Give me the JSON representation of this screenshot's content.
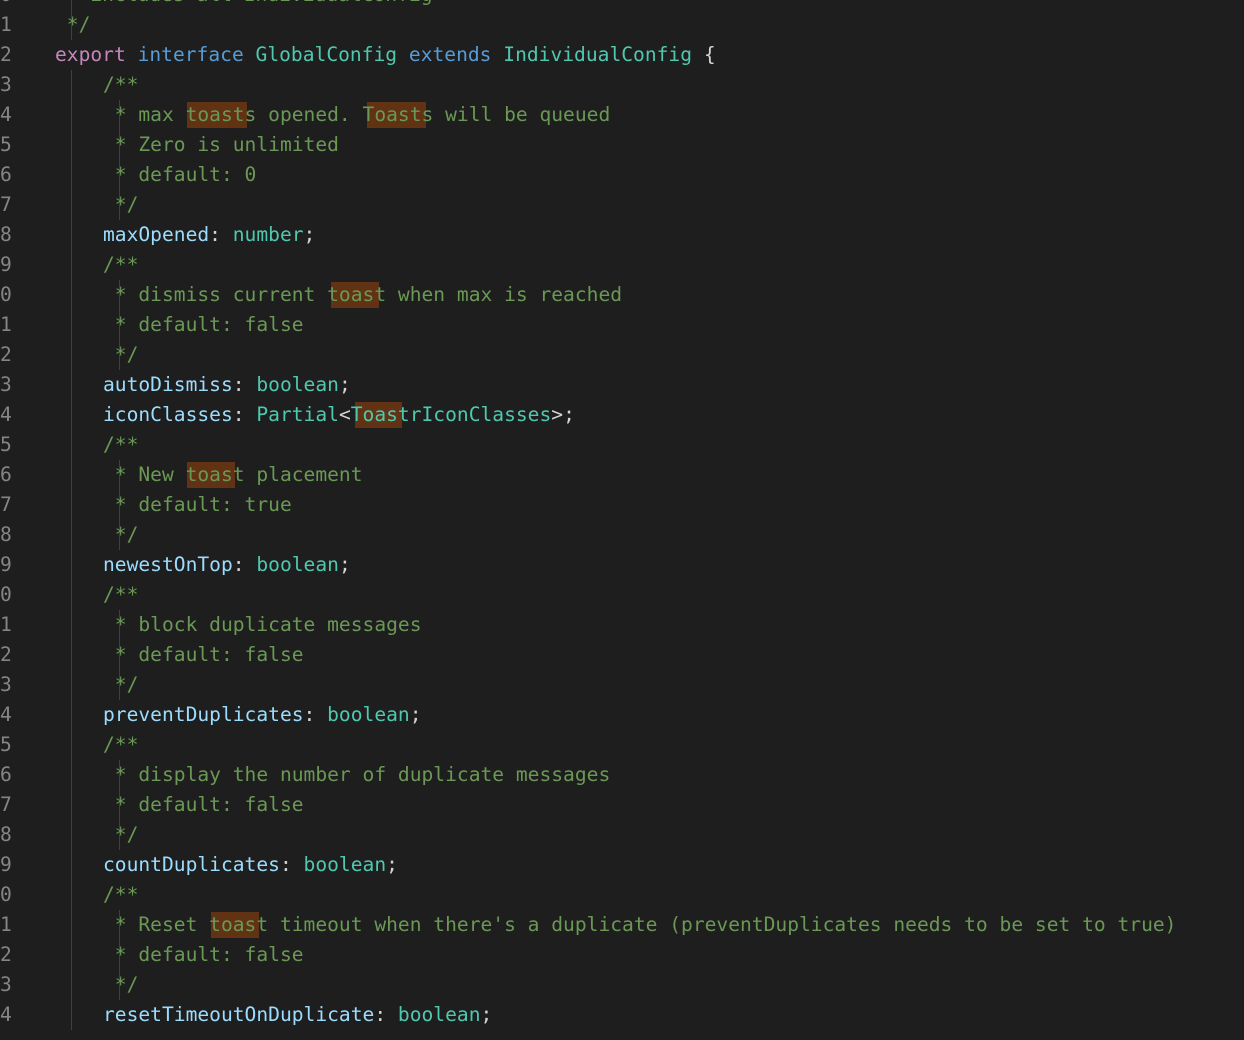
{
  "editor": {
    "theme": {
      "background": "#1e1e1e",
      "gutter_text": "#858585",
      "indent_guide": "#404040",
      "find_match": "#613214",
      "keyword": "#c586c0",
      "storage": "#569cd6",
      "type": "#4ec9b0",
      "property": "#9cdcfe",
      "comment": "#6a9955",
      "text": "#d4d4d4"
    },
    "lines": [
      {
        "num": "0",
        "indent": 0,
        "guides": [
          1
        ],
        "tokens": [
          {
            "t": " * includes all IndividualConfig",
            "c": "cm"
          }
        ],
        "matches": []
      },
      {
        "num": "1",
        "indent": 0,
        "guides": [
          1
        ],
        "tokens": [
          {
            "t": " */",
            "c": "cm"
          }
        ],
        "matches": []
      },
      {
        "num": "2",
        "indent": 0,
        "guides": [],
        "tokens": [
          {
            "t": "export",
            "c": "kw"
          },
          {
            "t": " ",
            "c": "pu"
          },
          {
            "t": "interface",
            "c": "st"
          },
          {
            "t": " ",
            "c": "pu"
          },
          {
            "t": "GlobalConfig",
            "c": "ty"
          },
          {
            "t": " ",
            "c": "pu"
          },
          {
            "t": "extends",
            "c": "st"
          },
          {
            "t": " ",
            "c": "pu"
          },
          {
            "t": "IndividualConfig",
            "c": "ty"
          },
          {
            "t": " {",
            "c": "pu"
          }
        ],
        "matches": []
      },
      {
        "num": "3",
        "indent": 1,
        "guides": [
          1
        ],
        "tokens": [
          {
            "t": "/**",
            "c": "cm"
          }
        ],
        "matches": []
      },
      {
        "num": "4",
        "indent": 1,
        "guides": [
          1,
          5
        ],
        "tokens": [
          {
            "t": " * max toasts opened. Toasts will be queued",
            "c": "cm"
          }
        ],
        "matches": [
          [
            7,
            12
          ],
          [
            22,
            27
          ]
        ]
      },
      {
        "num": "5",
        "indent": 1,
        "guides": [
          1,
          5
        ],
        "tokens": [
          {
            "t": " * Zero is unlimited",
            "c": "cm"
          }
        ],
        "matches": []
      },
      {
        "num": "6",
        "indent": 1,
        "guides": [
          1,
          5
        ],
        "tokens": [
          {
            "t": " * default: 0",
            "c": "cm"
          }
        ],
        "matches": []
      },
      {
        "num": "7",
        "indent": 1,
        "guides": [
          1,
          5
        ],
        "tokens": [
          {
            "t": " */",
            "c": "cm"
          }
        ],
        "matches": []
      },
      {
        "num": "8",
        "indent": 1,
        "guides": [
          1
        ],
        "tokens": [
          {
            "t": "maxOpened",
            "c": "pr"
          },
          {
            "t": ": ",
            "c": "pu"
          },
          {
            "t": "number",
            "c": "ty"
          },
          {
            "t": ";",
            "c": "pu"
          }
        ],
        "matches": []
      },
      {
        "num": "9",
        "indent": 1,
        "guides": [
          1
        ],
        "tokens": [
          {
            "t": "/**",
            "c": "cm"
          }
        ],
        "matches": []
      },
      {
        "num": "0",
        "indent": 1,
        "guides": [
          1,
          5
        ],
        "tokens": [
          {
            "t": " * dismiss current toast when max is reached",
            "c": "cm"
          }
        ],
        "matches": [
          [
            19,
            23
          ]
        ]
      },
      {
        "num": "1",
        "indent": 1,
        "guides": [
          1,
          5
        ],
        "tokens": [
          {
            "t": " * default: false",
            "c": "cm"
          }
        ],
        "matches": []
      },
      {
        "num": "2",
        "indent": 1,
        "guides": [
          1,
          5
        ],
        "tokens": [
          {
            "t": " */",
            "c": "cm"
          }
        ],
        "matches": []
      },
      {
        "num": "3",
        "indent": 1,
        "guides": [
          1
        ],
        "tokens": [
          {
            "t": "autoDismiss",
            "c": "pr"
          },
          {
            "t": ": ",
            "c": "pu"
          },
          {
            "t": "boolean",
            "c": "ty"
          },
          {
            "t": ";",
            "c": "pu"
          }
        ],
        "matches": []
      },
      {
        "num": "4",
        "indent": 1,
        "guides": [
          1
        ],
        "tokens": [
          {
            "t": "iconClasses",
            "c": "pr"
          },
          {
            "t": ": ",
            "c": "pu"
          },
          {
            "t": "Partial",
            "c": "ty"
          },
          {
            "t": "<",
            "c": "pu"
          },
          {
            "t": "ToastrIconClasses",
            "c": "ty"
          },
          {
            "t": ">;",
            "c": "pu"
          }
        ],
        "matches": [
          [
            21,
            25
          ]
        ]
      },
      {
        "num": "5",
        "indent": 1,
        "guides": [
          1
        ],
        "tokens": [
          {
            "t": "/**",
            "c": "cm"
          }
        ],
        "matches": []
      },
      {
        "num": "6",
        "indent": 1,
        "guides": [
          1,
          5
        ],
        "tokens": [
          {
            "t": " * New toast placement",
            "c": "cm"
          }
        ],
        "matches": [
          [
            7,
            11
          ]
        ]
      },
      {
        "num": "7",
        "indent": 1,
        "guides": [
          1,
          5
        ],
        "tokens": [
          {
            "t": " * default: true",
            "c": "cm"
          }
        ],
        "matches": []
      },
      {
        "num": "8",
        "indent": 1,
        "guides": [
          1,
          5
        ],
        "tokens": [
          {
            "t": " */",
            "c": "cm"
          }
        ],
        "matches": []
      },
      {
        "num": "9",
        "indent": 1,
        "guides": [
          1
        ],
        "tokens": [
          {
            "t": "newestOnTop",
            "c": "pr"
          },
          {
            "t": ": ",
            "c": "pu"
          },
          {
            "t": "boolean",
            "c": "ty"
          },
          {
            "t": ";",
            "c": "pu"
          }
        ],
        "matches": []
      },
      {
        "num": "0",
        "indent": 1,
        "guides": [
          1
        ],
        "tokens": [
          {
            "t": "/**",
            "c": "cm"
          }
        ],
        "matches": []
      },
      {
        "num": "1",
        "indent": 1,
        "guides": [
          1,
          5
        ],
        "tokens": [
          {
            "t": " * block duplicate messages",
            "c": "cm"
          }
        ],
        "matches": []
      },
      {
        "num": "2",
        "indent": 1,
        "guides": [
          1,
          5
        ],
        "tokens": [
          {
            "t": " * default: false",
            "c": "cm"
          }
        ],
        "matches": []
      },
      {
        "num": "3",
        "indent": 1,
        "guides": [
          1,
          5
        ],
        "tokens": [
          {
            "t": " */",
            "c": "cm"
          }
        ],
        "matches": []
      },
      {
        "num": "4",
        "indent": 1,
        "guides": [
          1
        ],
        "tokens": [
          {
            "t": "preventDuplicates",
            "c": "pr"
          },
          {
            "t": ": ",
            "c": "pu"
          },
          {
            "t": "boolean",
            "c": "ty"
          },
          {
            "t": ";",
            "c": "pu"
          }
        ],
        "matches": []
      },
      {
        "num": "5",
        "indent": 1,
        "guides": [
          1
        ],
        "tokens": [
          {
            "t": "/**",
            "c": "cm"
          }
        ],
        "matches": []
      },
      {
        "num": "6",
        "indent": 1,
        "guides": [
          1,
          5
        ],
        "tokens": [
          {
            "t": " * display the number of duplicate messages",
            "c": "cm"
          }
        ],
        "matches": []
      },
      {
        "num": "7",
        "indent": 1,
        "guides": [
          1,
          5
        ],
        "tokens": [
          {
            "t": " * default: false",
            "c": "cm"
          }
        ],
        "matches": []
      },
      {
        "num": "8",
        "indent": 1,
        "guides": [
          1,
          5
        ],
        "tokens": [
          {
            "t": " */",
            "c": "cm"
          }
        ],
        "matches": []
      },
      {
        "num": "9",
        "indent": 1,
        "guides": [
          1
        ],
        "tokens": [
          {
            "t": "countDuplicates",
            "c": "pr"
          },
          {
            "t": ": ",
            "c": "pu"
          },
          {
            "t": "boolean",
            "c": "ty"
          },
          {
            "t": ";",
            "c": "pu"
          }
        ],
        "matches": []
      },
      {
        "num": "0",
        "indent": 1,
        "guides": [
          1
        ],
        "tokens": [
          {
            "t": "/**",
            "c": "cm"
          }
        ],
        "matches": []
      },
      {
        "num": "1",
        "indent": 1,
        "guides": [
          1,
          5
        ],
        "tokens": [
          {
            "t": " * Reset toast timeout when there's a duplicate (preventDuplicates needs to be set to true)",
            "c": "cm"
          }
        ],
        "matches": [
          [
            9,
            13
          ]
        ]
      },
      {
        "num": "2",
        "indent": 1,
        "guides": [
          1,
          5
        ],
        "tokens": [
          {
            "t": " * default: false",
            "c": "cm"
          }
        ],
        "matches": []
      },
      {
        "num": "3",
        "indent": 1,
        "guides": [
          1,
          5
        ],
        "tokens": [
          {
            "t": " */",
            "c": "cm"
          }
        ],
        "matches": []
      },
      {
        "num": "4",
        "indent": 1,
        "guides": [
          1
        ],
        "tokens": [
          {
            "t": "resetTimeoutOnDuplicate",
            "c": "pr"
          },
          {
            "t": ": ",
            "c": "pu"
          },
          {
            "t": "boolean",
            "c": "ty"
          },
          {
            "t": ";",
            "c": "pu"
          }
        ],
        "matches": []
      }
    ]
  }
}
